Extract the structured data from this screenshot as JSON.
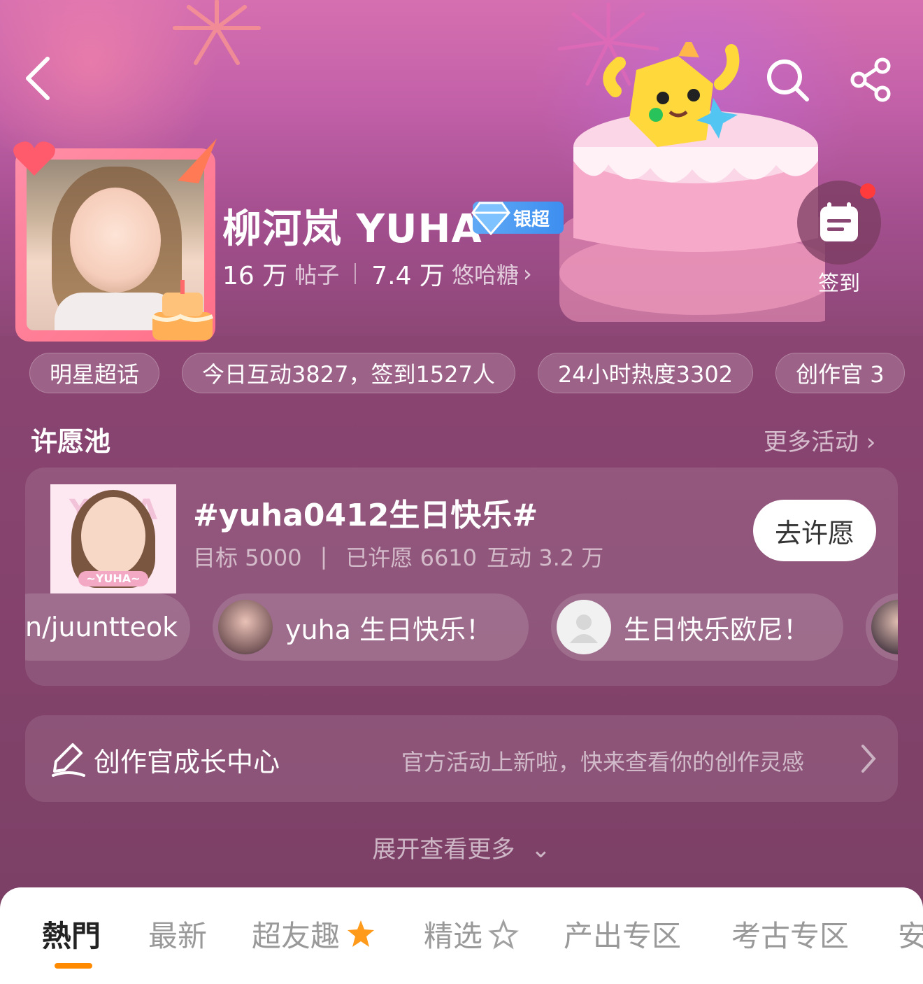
{
  "profile": {
    "name": "柳河岚 YUHA",
    "tier_badge": "银超",
    "posts_count": "16 万",
    "posts_label": "帖子",
    "fans_count": "7.4 万",
    "fans_label": "悠哈糖",
    "checkin_label": "签到"
  },
  "chips": [
    {
      "label": "明星超话"
    },
    {
      "label": "今日互动3827，签到1527人"
    },
    {
      "label": "24小时热度3302"
    },
    {
      "label": "创作官 3"
    }
  ],
  "wish_pool": {
    "section_title": "许愿池",
    "more_link": "更多活动 ›",
    "topic": "#yuha0412生日快乐#",
    "target": "目标 5000",
    "wished": "已许愿 6610",
    "interactions": "互动 3.2 万",
    "button": "去许愿",
    "thumb_watermark": "YUHA",
    "thumb_label": "~YUHA~",
    "bullets": [
      {
        "text": "n/juuntteok"
      },
      {
        "text": "yuha  生日快乐！"
      },
      {
        "text": "生日快乐欧尼！"
      }
    ]
  },
  "creator_center": {
    "title": "创作官成长中心",
    "desc": "官方活动上新啦，快来查看你的创作灵感"
  },
  "expand_label": "展开查看更多",
  "tabs": [
    {
      "label": "熱門",
      "active": true
    },
    {
      "label": "最新"
    },
    {
      "label": "超友趣"
    },
    {
      "label": "精选"
    },
    {
      "label": "产出专区"
    },
    {
      "label": "考古专区"
    },
    {
      "label": "安"
    }
  ],
  "colors": {
    "accent": "#ff8a00",
    "badge_blue": "#3d8ef0",
    "notification_red": "#ff3b3b",
    "page_bg": "#7a3f63"
  }
}
